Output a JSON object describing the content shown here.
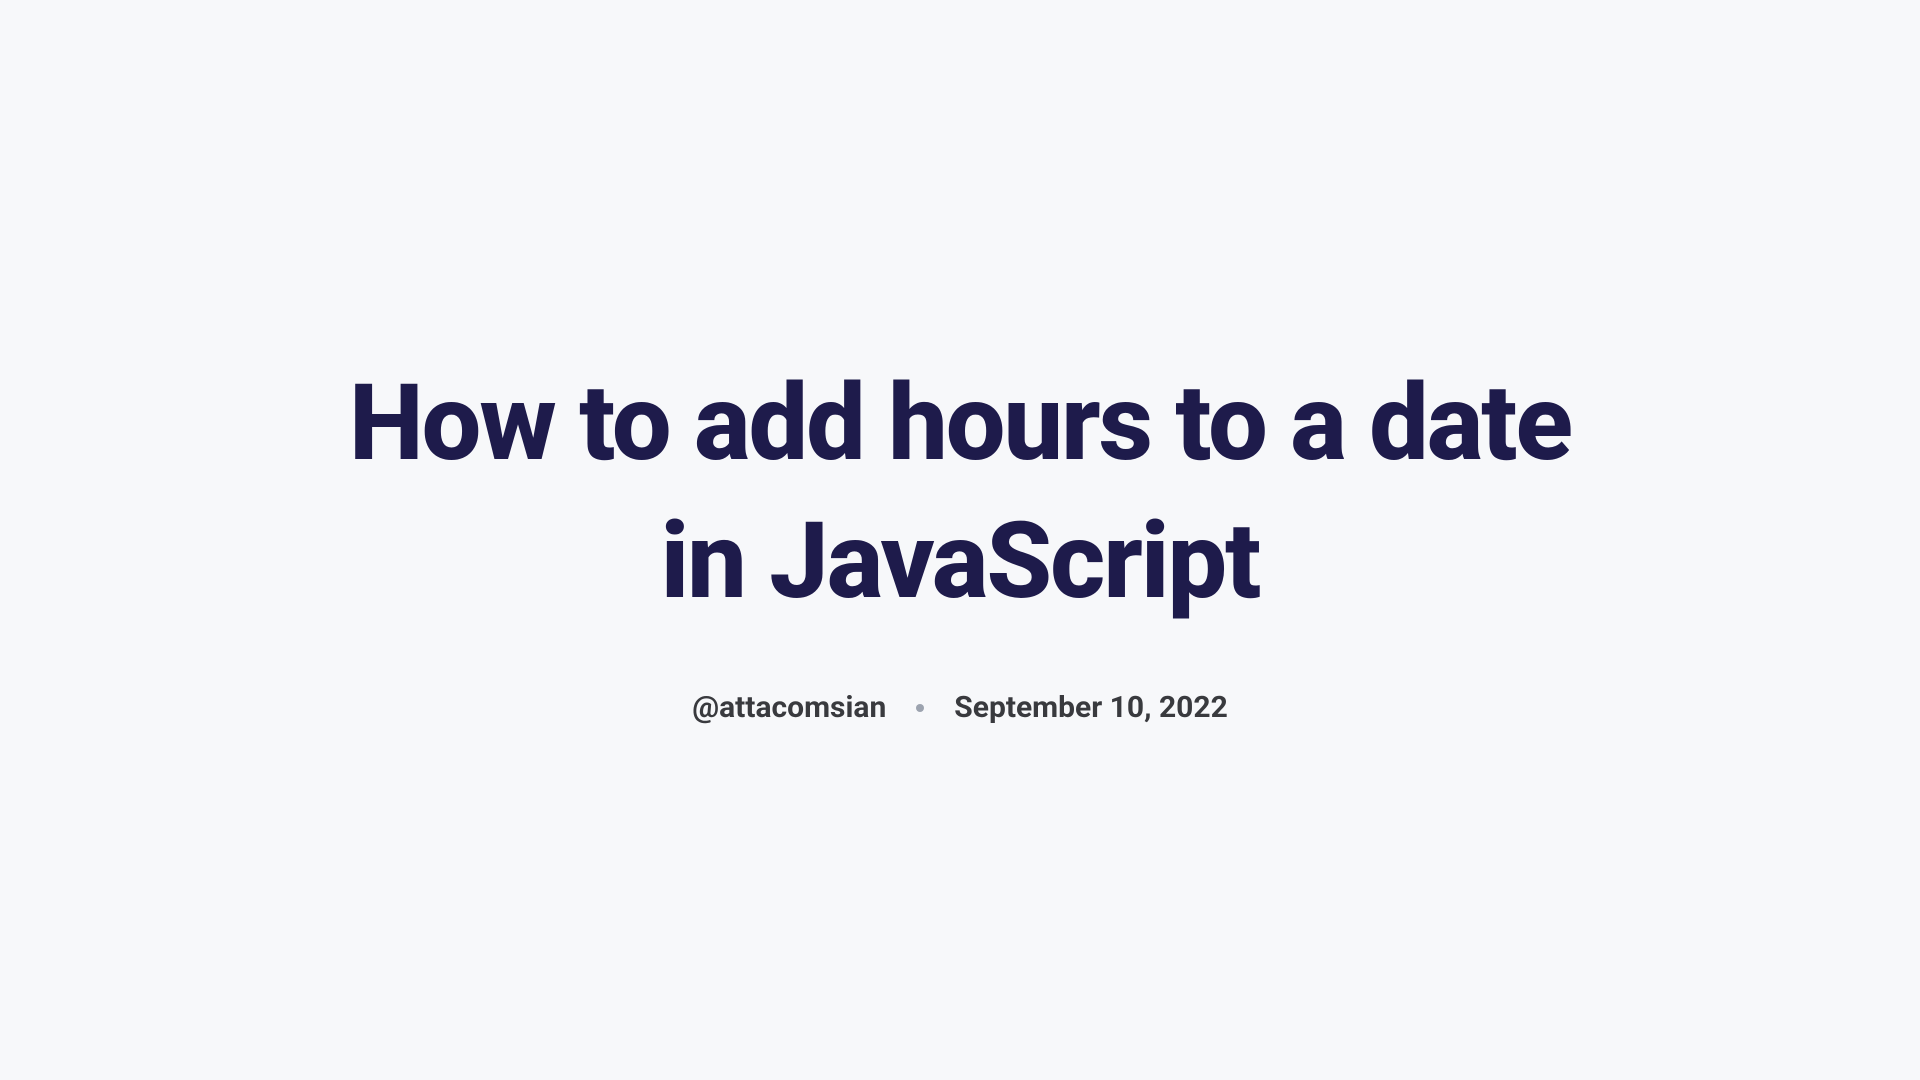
{
  "article": {
    "title": "How to add hours to a date in JavaScript",
    "author": "@attacomsian",
    "date": "September 10, 2022"
  }
}
